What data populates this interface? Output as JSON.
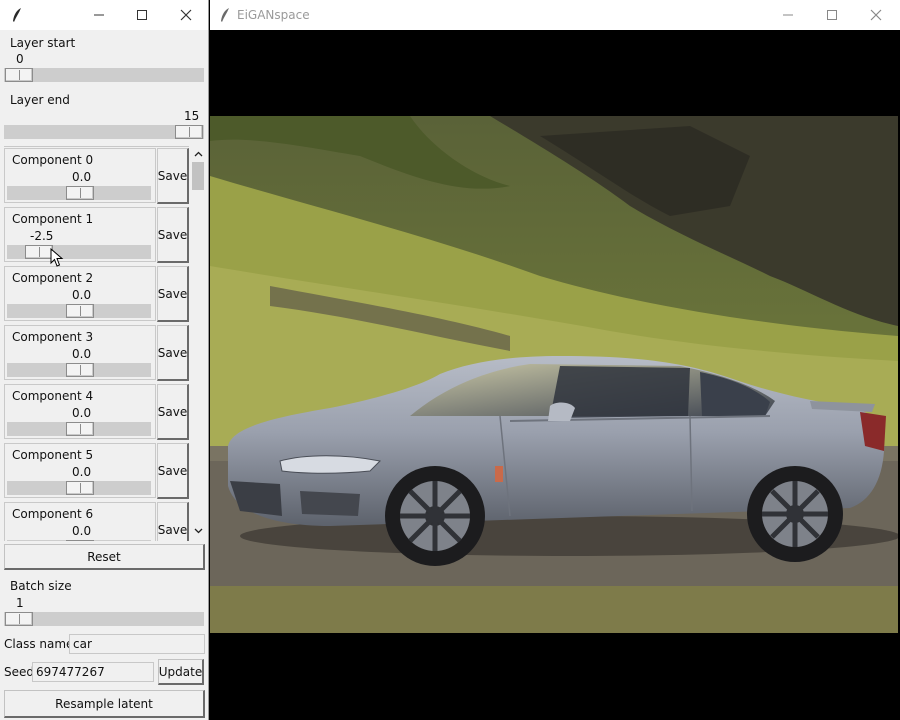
{
  "control_window": {
    "layer_start": {
      "label": "Layer start",
      "value": "0",
      "position": 0
    },
    "layer_end": {
      "label": "Layer end",
      "value": "15",
      "position": 1
    },
    "components": [
      {
        "name": "Component 0",
        "value": "0.0",
        "save": "Save"
      },
      {
        "name": "Component 1",
        "value": "-2.5",
        "save": "Save"
      },
      {
        "name": "Component 2",
        "value": "0.0",
        "save": "Save"
      },
      {
        "name": "Component 3",
        "value": "0.0",
        "save": "Save"
      },
      {
        "name": "Component 4",
        "value": "0.0",
        "save": "Save"
      },
      {
        "name": "Component 5",
        "value": "0.0",
        "save": "Save"
      },
      {
        "name": "Component 6",
        "value": "0.0",
        "save": "Save"
      }
    ],
    "reset_label": "Reset",
    "batch_size": {
      "label": "Batch size",
      "value": "1"
    },
    "class_name": {
      "label": "Class name",
      "value": "car"
    },
    "seed": {
      "label": "Seed",
      "value": "697477267",
      "update_label": "Update"
    },
    "resample_label": "Resample latent"
  },
  "image_window": {
    "title": "EiGANspace"
  },
  "icons": {
    "app": "feather-icon",
    "minimize": "minimize-icon",
    "maximize": "maximize-icon",
    "close": "close-icon",
    "scroll_up": "chevron-up-icon",
    "scroll_down": "chevron-down-icon",
    "cursor": "mouse-pointer-icon"
  },
  "colors": {
    "window_bg": "#f0f0f0",
    "trough": "#cdcdcd",
    "image_bg": "#000000",
    "car_body": "#9aa0ad",
    "grass": "#8f9a45"
  }
}
